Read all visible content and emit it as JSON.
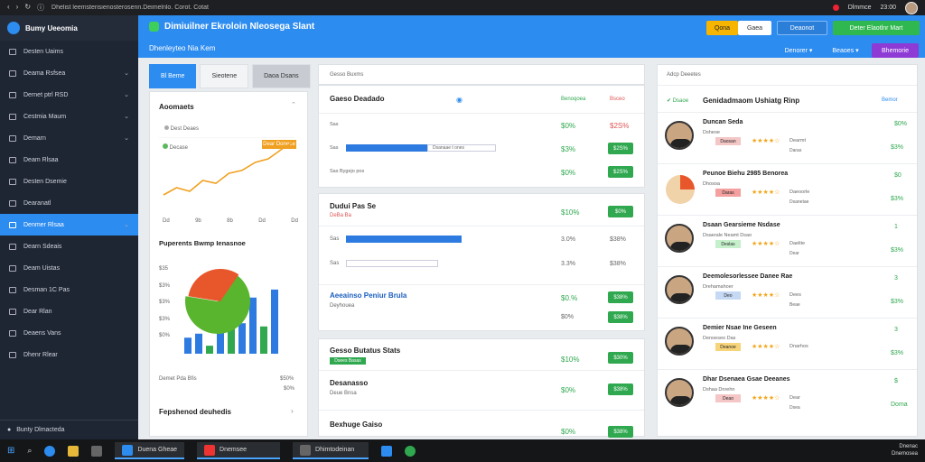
{
  "browser": {
    "url": "Dhelist leemsterisienosterosenn.Deimelnlo. Corot. Cotat",
    "right_label": "Dlmmce",
    "right_label2": "23:00"
  },
  "app": {
    "name": "Bumy Ueeomia"
  },
  "sidebar": {
    "items": [
      {
        "label": "Desten Uaims",
        "chev": false
      },
      {
        "label": "Deama Rsfsea",
        "chev": true
      },
      {
        "label": "Dernet ptrl RSD",
        "chev": true
      },
      {
        "label": "Cestmia Maum",
        "chev": true
      },
      {
        "label": "Demarn",
        "chev": true
      },
      {
        "label": "Deam Rlsaa",
        "chev": false
      },
      {
        "label": "Desten Dsemie",
        "chev": false
      },
      {
        "label": "Dearanatl",
        "chev": false
      },
      {
        "label": "Denmer Rlsaa",
        "chev": true,
        "active": true
      },
      {
        "label": "Dearn Sdeais",
        "chev": false
      },
      {
        "label": "Deam Uistas",
        "chev": false
      },
      {
        "label": "Desman 1C Pas",
        "chev": false
      },
      {
        "label": "Dear Rlan",
        "chev": false
      },
      {
        "label": "Deaens Vans",
        "chev": false
      },
      {
        "label": "Dhenr Rlear",
        "chev": false
      }
    ],
    "footer": "Bunty Dlmacteda"
  },
  "header": {
    "title": "Dimiuilner Ekroloin Nleosega  Slant",
    "subtitle": "Dhenleyteo Nia Kem",
    "btn_yellow": "Qona",
    "btn_white": "Gaea",
    "btn_blue": "Deaonot",
    "btn_green": "Deter Elaotlnr Mart",
    "dd1": "Denorer",
    "dd2": "Beaoes",
    "dd3": "Bhemorie"
  },
  "tabs": [
    "Bl Beme",
    "Sieotene",
    "Daoa Dsans"
  ],
  "colors": {
    "accent": "#2d8cf0",
    "green": "#2fa84f",
    "orange": "#f0a020"
  },
  "left_panel": {
    "section1_title": "Aoomaets",
    "legend1": "Dest Deaes",
    "legend2": "Decase",
    "callout": "Dear Doneee",
    "x_ticks": [
      "Dd",
      "9b",
      "8b",
      "Dd",
      "Dd"
    ],
    "section2_title": "Puperents Bwmp Ienasnoe",
    "y_ticks": [
      "$35",
      "$3%",
      "$3%",
      "$3%",
      "$0%"
    ],
    "legend_row": "Demet Pda Bfis",
    "legend_val": "$50%",
    "legend_val2": "$0%",
    "footer": "Fepshenod deuhedis",
    "line_chart": {
      "type": "line",
      "values": [
        2,
        3,
        2.5,
        4,
        3.6,
        5,
        5.4,
        6.5,
        7,
        8.3,
        9.5
      ]
    },
    "bar_chart": {
      "type": "bar",
      "values": [
        2,
        2.5,
        1,
        4.5,
        3.5,
        3.8,
        7,
        3.4,
        8
      ]
    },
    "pie_chart": {
      "type": "pie",
      "values": [
        68,
        32
      ]
    }
  },
  "center": {
    "header": "Gesso Buxms",
    "card1": {
      "title": "Gaeso Deadado",
      "col1": "Benoqoea",
      "col2": "Bsceo",
      "rows": [
        {
          "label": "Sas",
          "pct": "$0%",
          "val": "$2S%",
          "green": false
        },
        {
          "label": "Sas",
          "pct": "$3%",
          "val": "$2S%",
          "green": true
        },
        {
          "label": "Sas  Bygejo pos",
          "pct": "$0%",
          "val": "$2S%",
          "green": true
        }
      ],
      "bar_caption": "Dsanaae t ones"
    },
    "card2": {
      "title": "Dudui Pas Se",
      "subtitle": "DeBa Ba",
      "pct1": "$10%",
      "pill1": "$0%",
      "rows": [
        {
          "label": "Sas",
          "pct": "3.0%",
          "val": "$38%"
        },
        {
          "label": "Sas",
          "pct": "3.3%",
          "val": "$38%"
        }
      ],
      "sub_title": "Aeeainso Peniur Brula",
      "sub_sub": "Deyhouea",
      "sub_pct": "$0.%",
      "sub_pill": "$38%",
      "sub_pct2": "$0%",
      "sub_pill2": "$38%"
    },
    "card3": {
      "title": "Gesso Butatus Stats",
      "badge": "Dsees Basas",
      "pct": "$10%",
      "pill": "$30%",
      "row2_title": "Desanasso",
      "row2_sub": "Deue Bnsa",
      "row2_pct": "$0%",
      "row2_pill": "$38%",
      "row3_title": "Bexhuge Gaiso",
      "row3_sub": "Pecsa Bros",
      "row3_pct": "$0%",
      "row3_pill": "$38%"
    }
  },
  "right": {
    "header": "Adcp Deeetes",
    "subhead": "Dsaoe",
    "subtitle": "Genidadmaom Ushiatg Rinp",
    "sub_val": "Bemor",
    "people": [
      {
        "name": "Duncan Seda",
        "sub": "Dsheoe",
        "rating": "Dearmt",
        "tag": "Daosan",
        "tag2": "Daras",
        "pct": "$0%",
        "pct2": "$3%",
        "tag_color": "#f4c6c6"
      },
      {
        "name": "Peunoe Biehu 2985 Benorea",
        "sub": "Dhosoa",
        "rating": "Daeoorle",
        "tag": "Daras",
        "tag2": "Dsanetae",
        "pct": "$0",
        "pct2": "$3%",
        "tag_color": "#f4a0a0"
      },
      {
        "name": "Dsaan Gearsieme Nsdase",
        "sub": "Dsaerale Neamt Dsao",
        "rating": "Daelite",
        "tag": "Deslas",
        "tag2": "Dear",
        "pct": "1",
        "pct2": "$3%",
        "tag_color": "#c6f0cc"
      },
      {
        "name": "Deemolesorlessee Danee Rae",
        "sub": "Drehamahoer",
        "rating": "Dees",
        "tag": "Deo",
        "tag2": "Beae",
        "pct": "3",
        "pct2": "$3%",
        "tag_color": "#c6d9f4"
      },
      {
        "name": "Demier Nsae Ine Geseen",
        "sub": "Denoeseo Das",
        "rating": "Dnarhos",
        "tag": "Deanoe",
        "tag2": "",
        "pct": "3",
        "pct2": "$3%",
        "tag_color": "#f7d37a"
      },
      {
        "name": "Dhar Dsenaea Gsae Deeanes",
        "sub": "Dshaa Dnrehn",
        "rating": "Dear",
        "tag": "Deao",
        "tag2": "Dsea",
        "pct": "$",
        "pct2": "Doma",
        "tag_color": "#f4c6c6"
      }
    ]
  },
  "taskbar": {
    "apps": [
      "Duena Gheae",
      "Dnemsee",
      "Dhimtodeinan"
    ],
    "right_top": "Dnenac",
    "right_bottom": "Dnemosea"
  }
}
